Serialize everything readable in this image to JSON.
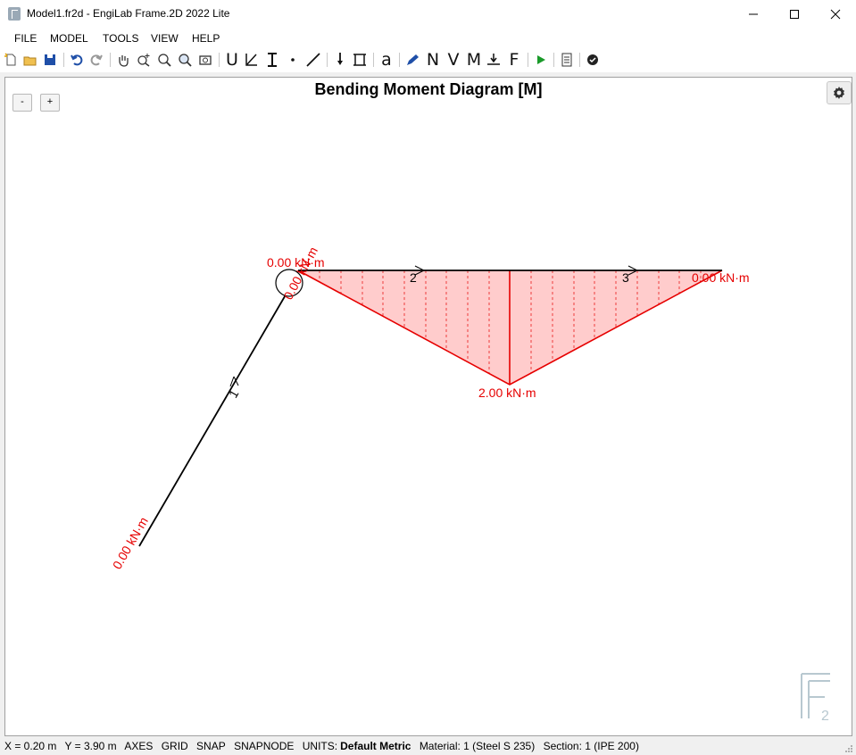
{
  "window": {
    "title": "Model1.fr2d - EngiLab Frame.2D 2022 Lite"
  },
  "menu": [
    "FILE",
    "MODEL",
    "TOOLS",
    "VIEW",
    "HELP"
  ],
  "toolbar": {
    "letters": {
      "u": "U",
      "n": "N",
      "v": "V",
      "m": "M",
      "f": "F",
      "a": "a"
    }
  },
  "canvas": {
    "title": "Bending Moment Diagram [M]",
    "zoom_out": "-",
    "zoom_in": "+"
  },
  "diagram": {
    "members": [
      "1",
      "2",
      "3"
    ],
    "moment_labels": {
      "member1_start": "0.00 kN·m",
      "node_top": "0.00 kN·m",
      "node_top_rot": "0.00 kN·m",
      "max": "2.00 kN·m",
      "end": "0.00 kN·m"
    },
    "colors": {
      "moment_line": "#e60000",
      "moment_fill": "#ffcccc",
      "member": "#000000"
    }
  },
  "status": {
    "x": "X = 0.20 m",
    "y": "Y = 3.90 m",
    "axes": "AXES",
    "grid": "GRID",
    "snap": "SNAP",
    "snapnode": "SNAPNODE",
    "units_label": "UNITS:",
    "units_value": "Default Metric",
    "material": "Material: 1 (Steel S 235)",
    "section": "Section: 1 (IPE 200)"
  }
}
